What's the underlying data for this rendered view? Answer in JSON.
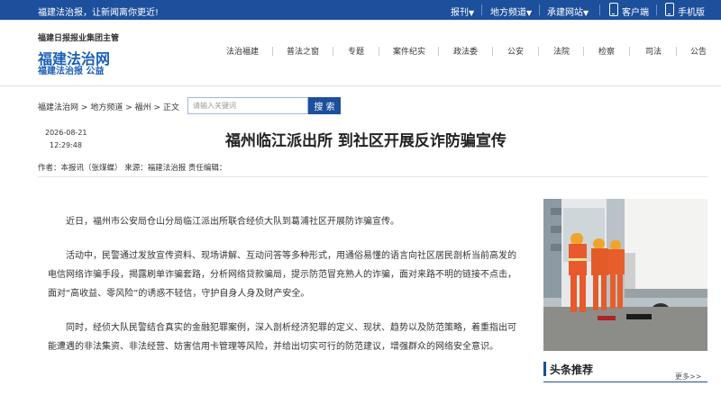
{
  "topbar": {
    "slogan": "福建法治报，让新闻离你更近!",
    "newspaper": "报刊",
    "local": "地方频道",
    "sites": "承建网站",
    "client": "客户端",
    "mobile": "手机版",
    "arrow": "▼"
  },
  "header": {
    "sponsor": "福建日报报业集团主管",
    "title": "福建法治网",
    "subtitle": "福建法治报 公益",
    "nav": [
      "法治福建",
      "普法之窗",
      "专题",
      "案件纪实",
      "政法委",
      "公安",
      "法院",
      "检察",
      "司法",
      "公告"
    ]
  },
  "breadcrumb": [
    "福建法治网",
    "地方频道",
    "福州",
    "正文"
  ],
  "breadcrumb_sep": ">",
  "search": {
    "placeholder": "请输入关键词",
    "button": "搜 索"
  },
  "article": {
    "date": "2026-08-21",
    "time": "12:29:48",
    "title": "福州临江派出所 到社区开展反诈防骗宣传",
    "meta": "作者：本报讯（张煤蝶） 来源：福建法治报 责任编辑：",
    "paragraphs": [
      "近日，福州市公安局仓山分局临江派出所联合经侦大队到葛浦社区开展防诈骗宣传。",
      "活动中，民警通过发放宣传资料、现场讲解、互动问答等多种形式，用通俗易懂的语言向社区居民剖析当前高发的电信网络诈骗手段，揭露刷单诈骗套路，分析网络贷款骗局，提示防范冒充熟人的诈骗，面对来路不明的链接不点击，面对“高收益、零风险”的诱惑不轻信，守护自身人身及财产安全。",
      "同时，经侦大队民警结合真实的金融犯罪案例，深入剖析经济犯罪的定义、现状、趋势以及防范策略，着重指出可能遭遇的非法集资、非法经营、妨害信用卡管理等风险，并给出切实可行的防范建议，增强群众的网络安全意识。"
    ]
  },
  "sidebar": {
    "recommend_title": "头条推荐",
    "more": "更多>>"
  },
  "colors": {
    "brand": "#1c4f9c",
    "brand_text": "#1c5fb8"
  }
}
